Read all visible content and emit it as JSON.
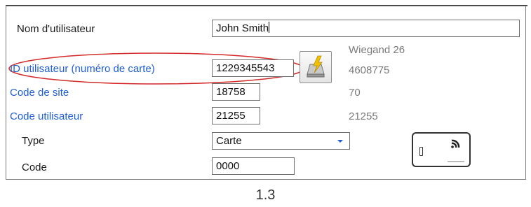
{
  "form": {
    "username_label": "Nom d'utilisateur",
    "username_value": "John Smith",
    "wiegand_header": "Wiegand 26",
    "user_id_label": "ID utilisateur (numéro de carte)",
    "user_id_value": "1229345543",
    "user_id_wiegand": "4608775",
    "site_code_label": "Code de site",
    "site_code_value": "18758",
    "site_code_wiegand": "70",
    "user_code_label": "Code utilisateur",
    "user_code_value": "21255",
    "user_code_wiegand": "21255",
    "type_label": "Type",
    "type_value": "Carte",
    "code_label": "Code",
    "code_value": "0000",
    "card_icon": "rfid-card-icon",
    "enroll_icon": "card-reader-icon"
  },
  "highlight_color": "#d42a2a",
  "link_color": "#1f5fd6",
  "caption": "1.3"
}
